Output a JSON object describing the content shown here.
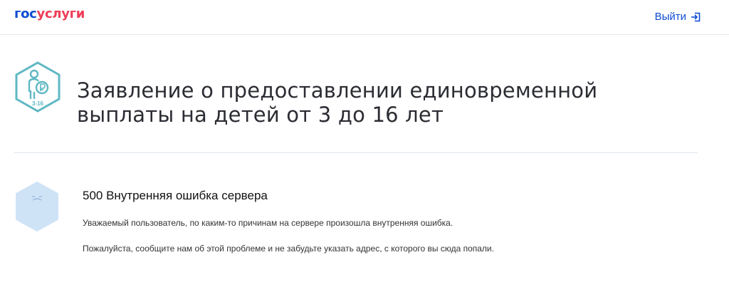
{
  "header": {
    "logo_part1": "гос",
    "logo_part2": "услуги",
    "logout_label": "Выйти",
    "logout_icon": "logout-icon"
  },
  "service": {
    "icon": "child-with-ruble-icon",
    "icon_label": "3-16",
    "icon_color": "#5fb8c4",
    "title_line1": "Заявление о предоставлении единовременной",
    "title_line2": "выплаты на детей от 3 до 16 лет"
  },
  "error": {
    "icon": "sad-face-hexagon-icon",
    "title": "500 Внутренняя ошибка сервера",
    "message1": "Уважаемый пользователь, по каким-то причинам на сервере произошла внутренняя ошибка.",
    "message2": "Пожалуйста, сообщите нам об этой проблеме и не забудьте указать адрес, с которого вы сюда попали."
  },
  "colors": {
    "brand_blue": "#0d4cd3",
    "brand_red": "#ee3f58",
    "error_icon_fill": "#cfe3f7"
  }
}
